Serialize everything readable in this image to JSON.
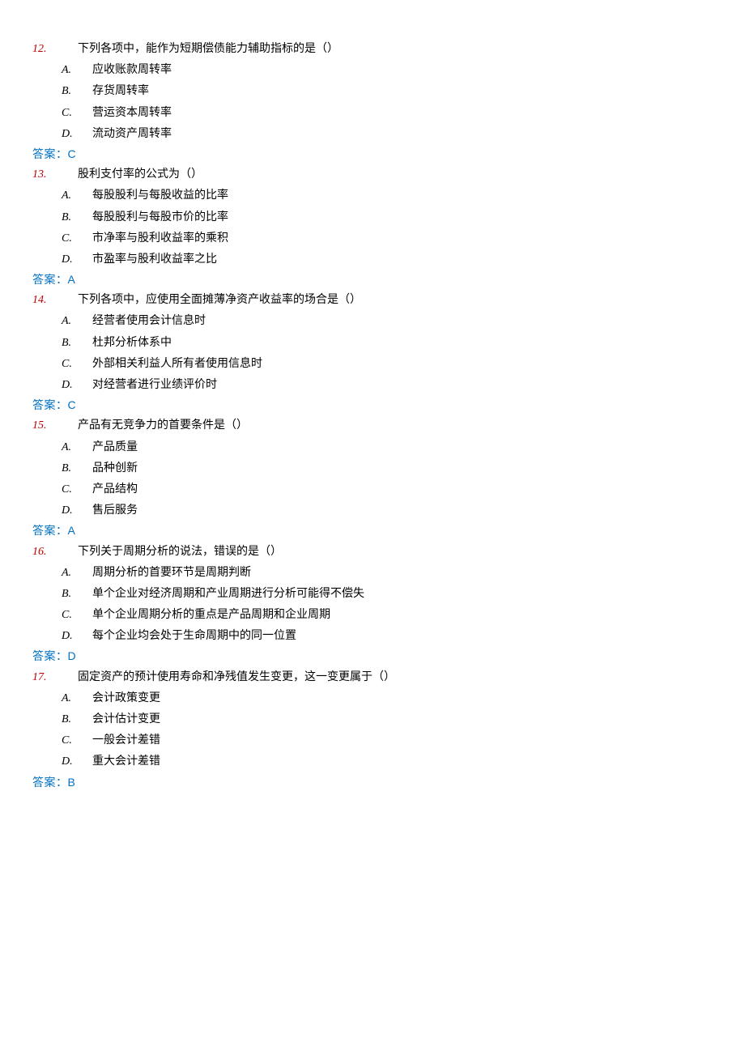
{
  "answer_prefix": "答案：",
  "questions": [
    {
      "number": "12.",
      "text": "下列各项中，能作为短期偿债能力辅助指标的是（）",
      "options": [
        {
          "letter": "A.",
          "text": "应收账款周转率"
        },
        {
          "letter": "B.",
          "text": "存货周转率"
        },
        {
          "letter": "C.",
          "text": "营运资本周转率"
        },
        {
          "letter": "D.",
          "text": "流动资产周转率"
        }
      ],
      "answer": "C"
    },
    {
      "number": "13.",
      "text": "股利支付率的公式为（）",
      "options": [
        {
          "letter": "A.",
          "text": "每股股利与每股收益的比率"
        },
        {
          "letter": "B.",
          "text": "每股股利与每股市价的比率"
        },
        {
          "letter": "C.",
          "text": "市净率与股利收益率的乘积"
        },
        {
          "letter": "D.",
          "text": "市盈率与股利收益率之比"
        }
      ],
      "answer": "A"
    },
    {
      "number": "14.",
      "text": "下列各项中，应使用全面摊薄净资产收益率的场合是（）",
      "options": [
        {
          "letter": "A.",
          "text": "经营者使用会计信息时"
        },
        {
          "letter": "B.",
          "text": "杜邦分析体系中"
        },
        {
          "letter": "C.",
          "text": "外部相关利益人所有者使用信息时"
        },
        {
          "letter": "D.",
          "text": "对经营者进行业绩评价时"
        }
      ],
      "answer": "C"
    },
    {
      "number": "15.",
      "text": "产品有无竞争力的首要条件是（）",
      "options": [
        {
          "letter": "A.",
          "text": "产品质量"
        },
        {
          "letter": "B.",
          "text": "品种创新"
        },
        {
          "letter": "C.",
          "text": "产品结构"
        },
        {
          "letter": "D.",
          "text": "售后服务"
        }
      ],
      "answer": "A"
    },
    {
      "number": "16.",
      "text": "下列关于周期分析的说法，错误的是（）",
      "options": [
        {
          "letter": "A.",
          "text": "周期分析的首要环节是周期判断"
        },
        {
          "letter": "B.",
          "text": "单个企业对经济周期和产业周期进行分析可能得不偿失"
        },
        {
          "letter": "C.",
          "text": "单个企业周期分析的重点是产品周期和企业周期"
        },
        {
          "letter": "D.",
          "text": "每个企业均会处于生命周期中的同一位置"
        }
      ],
      "answer": "D"
    },
    {
      "number": "17.",
      "text": "固定资产的预计使用寿命和净残值发生变更，这一变更属于（）",
      "options": [
        {
          "letter": "A.",
          "text": "会计政策变更"
        },
        {
          "letter": "B.",
          "text": "会计估计变更"
        },
        {
          "letter": "C.",
          "text": "一般会计差错"
        },
        {
          "letter": "D.",
          "text": "重大会计差错"
        }
      ],
      "answer": "B"
    }
  ]
}
